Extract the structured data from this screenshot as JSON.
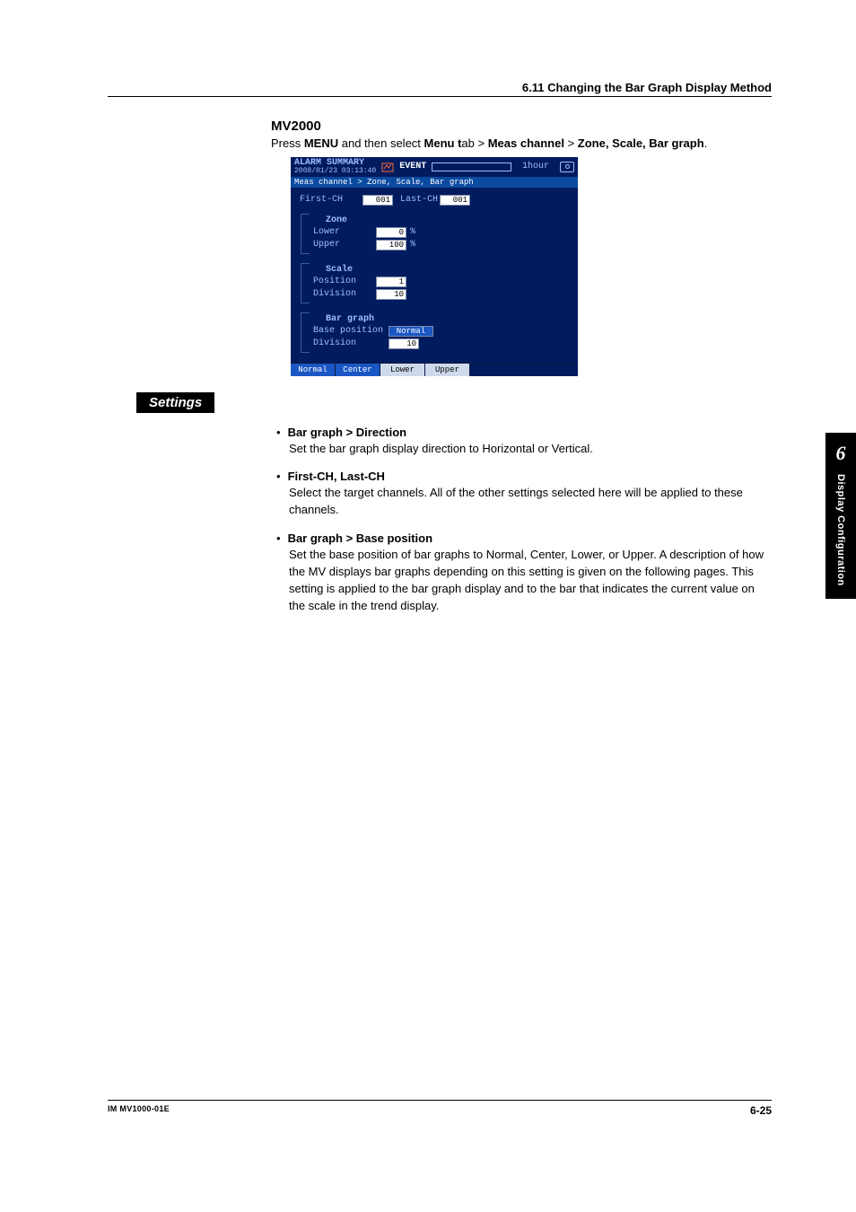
{
  "header": {
    "section": "6.11  Changing the Bar Graph Display Method"
  },
  "model": "MV2000",
  "instruction": {
    "p1": "Press ",
    "b1": "MENU",
    "p2": " and then select ",
    "b2": "Menu t",
    "p3": "ab > ",
    "b3": "Meas channel",
    "p4": " > ",
    "b4": "Zone, Scale, Bar graph",
    "p5": "."
  },
  "device": {
    "title": "ALARM SUMMARY",
    "timestamp": "2008/01/23 03:13:40",
    "event_label": "EVENT",
    "duration": "1hour",
    "breadcrumb": "Meas channel > Zone, Scale, Bar graph",
    "first_ch_label": "First-CH",
    "first_ch_val": "001",
    "last_ch_label": "Last-CH",
    "last_ch_val": "001",
    "zone": {
      "title": "Zone",
      "lower_label": "Lower",
      "lower_val": "0",
      "upper_label": "Upper",
      "upper_val": "100",
      "unit": "%"
    },
    "scale": {
      "title": "Scale",
      "position_label": "Position",
      "position_val": "1",
      "division_label": "Division",
      "division_val": "10"
    },
    "bargraph": {
      "title": "Bar graph",
      "base_label": "Base position",
      "base_val": "Normal",
      "division_label": "Division",
      "division_val": "10"
    },
    "buttons": {
      "normal": "Normal",
      "center": "Center",
      "lower": "Lower",
      "upper": "Upper"
    }
  },
  "settings_heading": "Settings",
  "bullets": {
    "b1": {
      "h": "Bar graph > Direction",
      "p": "Set the bar graph display direction to Horizontal or Vertical."
    },
    "b2": {
      "h": "First-CH, Last-CH",
      "p": "Select the target channels. All of the other settings selected here will be applied to these channels."
    },
    "b3": {
      "h": "Bar graph > Base position",
      "p": "Set the base position of bar graphs to Normal, Center, Lower, or Upper. A description of how the MV displays bar graphs depending on this setting is given on the following pages. This setting is applied to the bar graph display and to the bar that indicates the current value on the scale in the trend display."
    }
  },
  "tab": {
    "number": "6",
    "label": "Display Configuration"
  },
  "footer": {
    "left": "IM MV1000-01E",
    "right": "6-25"
  }
}
